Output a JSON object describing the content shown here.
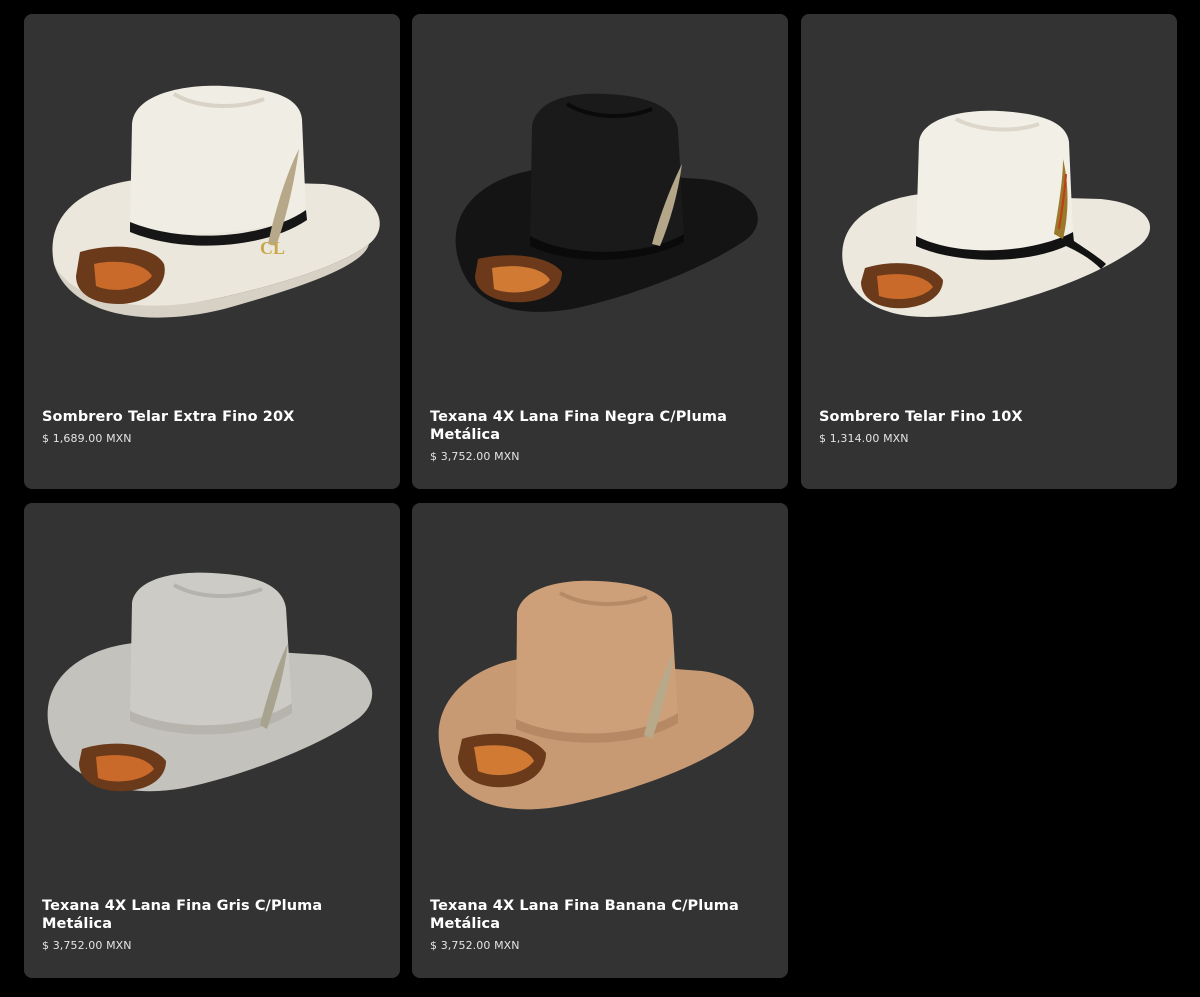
{
  "products": [
    {
      "name": "Sombrero Telar Extra Fino 20X",
      "price": "$ 1,689.00 MXN",
      "hat_color": "#ece9df",
      "band_color": "#1a1a1a",
      "icon": "straw-hat-image"
    },
    {
      "name": "Texana 4X Lana Fina Negra C/Pluma Metálica",
      "price": "$ 3,752.00 MXN",
      "hat_color": "#151515",
      "band_color": "#0a0a0a",
      "icon": "black-felt-hat-image"
    },
    {
      "name": "Sombrero Telar Fino 10X",
      "price": "$ 1,314.00 MXN",
      "hat_color": "#efece2",
      "band_color": "#111111",
      "icon": "straw-hat-image"
    },
    {
      "name": "Texana 4X Lana Fina Gris C/Pluma Metálica",
      "price": "$ 3,752.00 MXN",
      "hat_color": "#c9c7c2",
      "band_color": "#b9b6b0",
      "icon": "grey-felt-hat-image"
    },
    {
      "name": "Texana 4X Lana Fina Banana C/Pluma Metálica",
      "price": "$ 3,752.00 MXN",
      "hat_color": "#c99a73",
      "band_color": "#b88a64",
      "icon": "banana-felt-hat-image"
    }
  ],
  "colors": {
    "background": "#000000",
    "card": "#333333",
    "title": "#ffffff",
    "price": "#e4e4e4"
  }
}
